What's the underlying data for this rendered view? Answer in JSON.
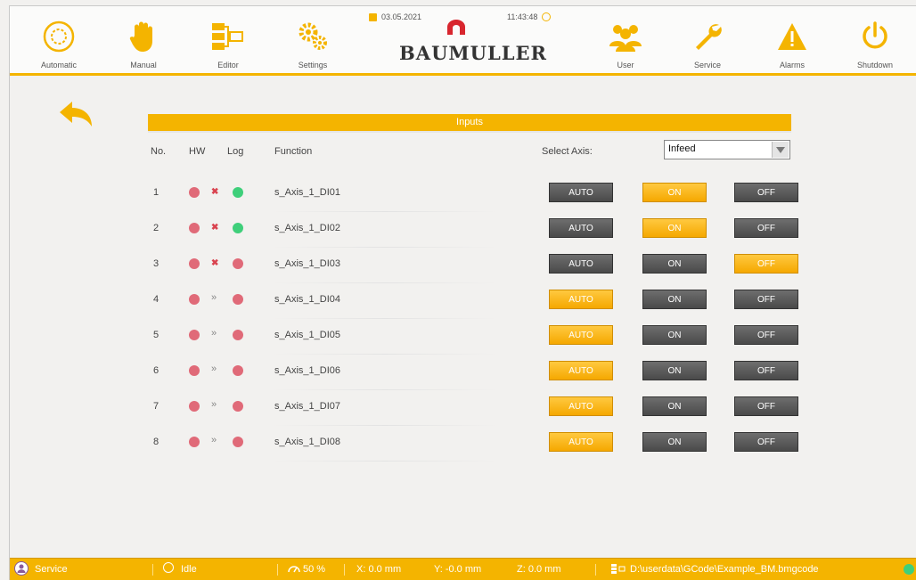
{
  "topbar": {
    "nav": [
      {
        "id": "automatic",
        "label": "Automatic",
        "icon": "automatic-icon"
      },
      {
        "id": "manual",
        "label": "Manual",
        "icon": "hand-icon"
      },
      {
        "id": "editor",
        "label": "Editor",
        "icon": "editor-icon"
      },
      {
        "id": "settings",
        "label": "Settings",
        "icon": "gears-icon"
      },
      {
        "id": "user",
        "label": "User",
        "icon": "users-icon"
      },
      {
        "id": "service",
        "label": "Service",
        "icon": "wrench-icon"
      },
      {
        "id": "alarms",
        "label": "Alarms",
        "icon": "warning-icon"
      },
      {
        "id": "shutdown",
        "label": "Shutdown",
        "icon": "power-icon"
      }
    ],
    "date": "03.05.2021",
    "time": "11:43:48",
    "brand": "BAUMULLER"
  },
  "panel": {
    "title": "Inputs",
    "headers": {
      "no": "No.",
      "hw": "HW",
      "log": "Log",
      "function": "Function",
      "select_axis": "Select Axis:"
    },
    "selected_axis": "Infeed",
    "rows": [
      {
        "no": "1",
        "hw": "red",
        "mark": "x",
        "log": "green",
        "function": "s_Axis_1_DI01",
        "active": "on"
      },
      {
        "no": "2",
        "hw": "red",
        "mark": "x",
        "log": "green",
        "function": "s_Axis_1_DI02",
        "active": "on"
      },
      {
        "no": "3",
        "hw": "red",
        "mark": "x",
        "log": "red",
        "function": "s_Axis_1_DI03",
        "active": "off"
      },
      {
        "no": "4",
        "hw": "red",
        "mark": "»",
        "log": "red",
        "function": "s_Axis_1_DI04",
        "active": "auto"
      },
      {
        "no": "5",
        "hw": "red",
        "mark": "»",
        "log": "red",
        "function": "s_Axis_1_DI05",
        "active": "auto"
      },
      {
        "no": "6",
        "hw": "red",
        "mark": "»",
        "log": "red",
        "function": "s_Axis_1_DI06",
        "active": "auto"
      },
      {
        "no": "7",
        "hw": "red",
        "mark": "»",
        "log": "red",
        "function": "s_Axis_1_DI07",
        "active": "auto"
      },
      {
        "no": "8",
        "hw": "red",
        "mark": "»",
        "log": "red",
        "function": "s_Axis_1_DI08",
        "active": "auto"
      }
    ],
    "button_labels": {
      "auto": "AUTO",
      "on": "ON",
      "off": "OFF"
    }
  },
  "statusbar": {
    "user": "Service",
    "state": "Idle",
    "feed": "50 %",
    "x": "X:  0.0 mm",
    "y": "Y:  -0.0 mm",
    "z": "Z:  0.0 mm",
    "file": "D:\\userdata\\GCode\\Example_BM.bmgcode"
  },
  "colors": {
    "accent": "#f4b400",
    "led_red": "#e06a78",
    "led_green": "#3fcf7a",
    "mark_red": "#d9434f",
    "button_dark": "#555555"
  }
}
